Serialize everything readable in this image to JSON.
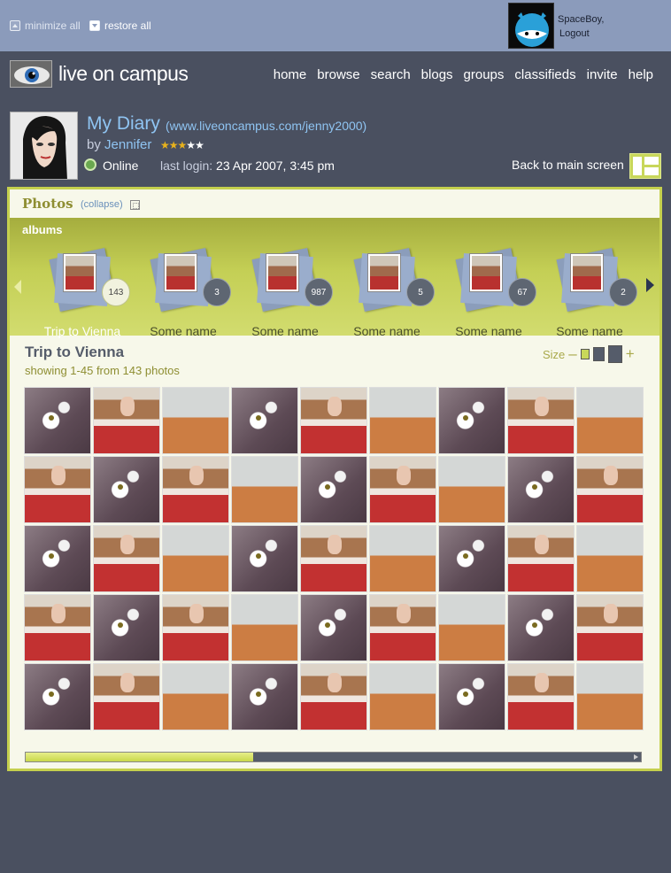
{
  "topbar": {
    "minimize_all": "minimize all",
    "restore_all": "restore all",
    "username": "SpaceBoy,",
    "logout": "Logout"
  },
  "header": {
    "logo_text": "live on campus",
    "nav": [
      "home",
      "browse",
      "search",
      "blogs",
      "groups",
      "classifieds",
      "invite",
      "help"
    ]
  },
  "profile": {
    "title": "My Diary",
    "url": "(www.liveoncampus.com/jenny2000)",
    "by": "by",
    "name": "Jennifer",
    "rating": 3,
    "rating_max": 5,
    "status": "Online",
    "last_login_label": "last login:",
    "last_login_value": "23 Apr 2007, 3:45 pm",
    "back_label": "Back to main screen"
  },
  "photos_panel": {
    "title": "Photos",
    "collapse": "(collapse)",
    "albums_label": "albums",
    "albums": [
      {
        "name": "Trip to Vienna",
        "count": "143",
        "active": true
      },
      {
        "name": "Some name",
        "count": "3"
      },
      {
        "name": "Some name",
        "count": "987"
      },
      {
        "name": "Some name",
        "count": "5"
      },
      {
        "name": "Some name",
        "count": "67"
      },
      {
        "name": "Some name",
        "count": "2"
      }
    ],
    "album_title": "Trip to Vienna",
    "showing": "showing 1-45 from 143 photos",
    "size_label": "Size",
    "size_minus": "–",
    "size_plus": "+",
    "photo_rows": [
      [
        "flower",
        "girl",
        "field",
        "flower",
        "girl",
        "field",
        "flower",
        "girl",
        "field"
      ],
      [
        "girl",
        "flower",
        "girl",
        "field",
        "flower",
        "girl",
        "field",
        "flower",
        "girl"
      ],
      [
        "flower",
        "girl",
        "field",
        "flower",
        "girl",
        "field",
        "flower",
        "girl",
        "field"
      ],
      [
        "girl",
        "flower",
        "girl",
        "field",
        "flower",
        "girl",
        "field",
        "flower",
        "girl"
      ],
      [
        "flower",
        "girl",
        "field",
        "flower",
        "girl",
        "field",
        "flower",
        "girl",
        "field"
      ]
    ],
    "scroll_progress": 0.37
  },
  "colors": {
    "page_bg": "#4a5060",
    "topbar_bg": "#8b9bbb",
    "accent_green": "#c5d04e",
    "link_blue": "#8fc4f2"
  }
}
